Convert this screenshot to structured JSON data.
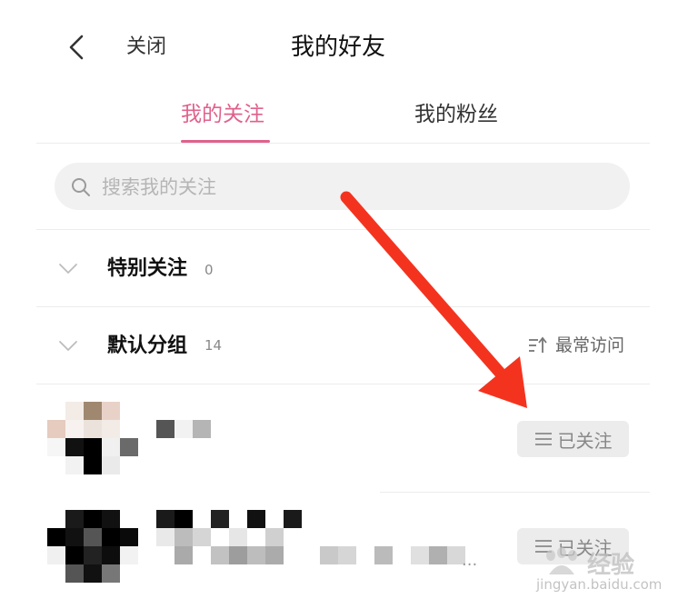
{
  "header": {
    "back_icon": "chevron-left-icon",
    "close_label": "关闭",
    "title": "我的好友"
  },
  "tabs": [
    {
      "label": "我的关注",
      "active": true
    },
    {
      "label": "我的粉丝",
      "active": false
    }
  ],
  "search": {
    "icon": "search-icon",
    "placeholder": "搜索我的关注",
    "value": ""
  },
  "groups": [
    {
      "label": "特别关注",
      "count": "0",
      "icon": "chevron-down-icon"
    },
    {
      "label": "默认分组",
      "count": "14",
      "icon": "chevron-down-icon"
    }
  ],
  "sort": {
    "icon": "sort-icon",
    "label": "最常访问"
  },
  "friends": [
    {
      "follow_label": "已关注",
      "follow_icon": "menu-icon"
    },
    {
      "follow_label": "已关注",
      "follow_icon": "menu-icon",
      "name_suffix": "..."
    }
  ],
  "watermark": {
    "text1": "经验",
    "text2": "jingyan.baidu.com"
  },
  "colors": {
    "accent": "#e0618d",
    "button_bg": "#ececec",
    "arrow": "#f4331f"
  }
}
